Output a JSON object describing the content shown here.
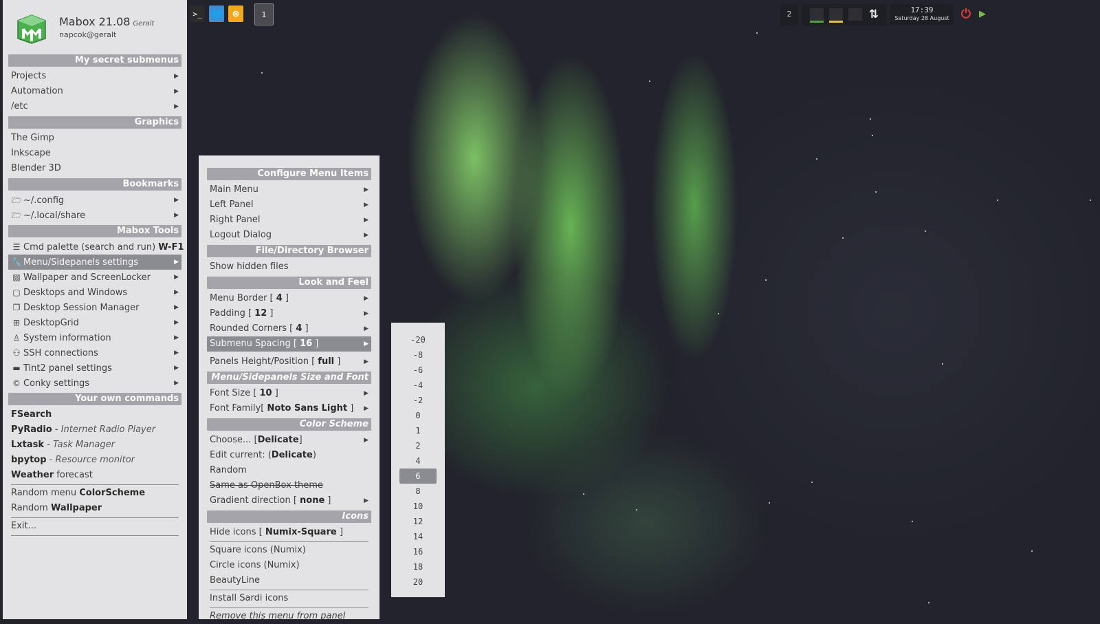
{
  "topbar": {
    "workspace_current": "1",
    "workspace_other": "2",
    "clock_time": "17:39",
    "clock_date": "Saturday 28 August",
    "colors": {
      "power": "#e03a3a",
      "play": "#7bc043",
      "ubuntu_orange": "#f2a81d"
    }
  },
  "header": {
    "app_name": "Mabox 21.08",
    "codename": "Geralt",
    "user": "napcok@geralt"
  },
  "main_menu": {
    "sec_submenus": "My secret submenus",
    "projects": "Projects",
    "automation": "Automation",
    "etc": "/etc",
    "sec_graphics": "Graphics",
    "gimp": "The Gimp",
    "inkscape": "Inkscape",
    "blender": "Blender 3D",
    "sec_bookmarks": "Bookmarks",
    "config": "~/.config",
    "localshare": "~/.local/share",
    "sec_tools": "Mabox Tools",
    "cmd_palette": "Cmd palette (search and run) ",
    "cmd_palette_key": "W-F1",
    "sidepanels": "Menu/Sidepanels settings",
    "wallpaper": "Wallpaper and ScreenLocker",
    "desktops": "Desktops and Windows",
    "session": "Desktop Session Manager",
    "grid": "DesktopGrid",
    "sysinfo": "System information",
    "ssh": "SSH connections",
    "tint2": "Tint2 panel settings",
    "conky": "Conky settings",
    "sec_own": "Your own commands",
    "fsearch": "FSearch",
    "pyradio": "PyRadio",
    "pyradio_desc": "Internet Radio Player",
    "lxtask": "Lxtask",
    "lxtask_desc": "Task Manager",
    "bpytop": "bpytop",
    "bpytop_desc": "Resource monitor",
    "weather": "Weather",
    "weather_desc": " forecast",
    "random_menu": "Random menu ",
    "random_menu_b": "ColorScheme",
    "random_wp": "Random ",
    "random_wp_b": "Wallpaper",
    "exit": "Exit..."
  },
  "sub_menu": {
    "sec_configure": "Configure Menu Items",
    "main_menu": "Main Menu",
    "left_panel": "Left Panel",
    "right_panel": "Right Panel",
    "logout": "Logout Dialog",
    "sec_browser": "File/Directory Browser",
    "hidden": "Show hidden files",
    "sec_look": "Look and Feel",
    "border": "Menu Border [ ",
    "border_v": "4",
    "border_e": " ]",
    "padding": "Padding [ ",
    "padding_v": "12",
    "padding_e": " ]",
    "corners": "Rounded Corners [ ",
    "corners_v": "4",
    "corners_e": " ]",
    "spacing": "Submenu Spacing [ ",
    "spacing_v": "16",
    "spacing_e": " ]",
    "panels": "Panels Height/Position [ ",
    "panels_v": "full",
    "panels_e": " ]",
    "sec_size": "Menu/Sidepanels Size and Font",
    "fontsize": "Font Size [ ",
    "fontsize_v": "10",
    "fontsize_e": " ]",
    "fontfam": "Font Family[ ",
    "fontfam_v": "Noto Sans Light",
    "fontfam_e": " ]",
    "sec_color": "Color Scheme",
    "choose": "Choose... [",
    "choose_v": "Delicate",
    "choose_e": "]",
    "edit": "Edit current: (",
    "edit_v": "Delicate",
    "edit_e": ")",
    "random": "Random",
    "same_ob": "Same as OpenBox theme",
    "gradient": "Gradient direction [ ",
    "gradient_v": "none",
    "gradient_e": " ]",
    "sec_icons": "Icons",
    "hide_icons": "Hide icons  [ ",
    "hide_icons_v": "Numix-Square",
    "hide_icons_e": " ]",
    "square": "Square icons (Numix)",
    "circle": "Circle icons (Numix)",
    "beautyline": "BeautyLine",
    "sardi": "Install Sardi icons",
    "remove": "Remove this menu from panel"
  },
  "spacing_menu": {
    "options": [
      "-20",
      "-8",
      "-6",
      "-4",
      "-2",
      "0",
      "1",
      "2",
      "4",
      "6",
      "8",
      "10",
      "12",
      "14",
      "16",
      "18",
      "20"
    ],
    "selected": "6"
  }
}
